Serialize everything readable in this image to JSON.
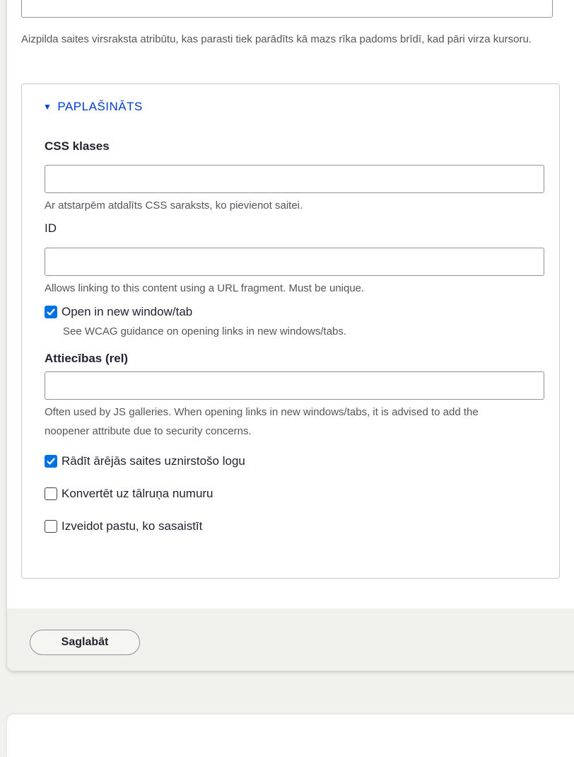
{
  "title_field": {
    "value": "",
    "description": "Aizpilda saites virsraksta atribūtu, kas parasti tiek parādīts kā mazs rīka padoms brīdī, kad pāri virza kursoru."
  },
  "advanced": {
    "summary": "PAPLAŠINĀTS",
    "css": {
      "label": "CSS klases",
      "value": "",
      "description": "Ar atstarpēm atdalīts CSS saraksts, ko pievienot saitei."
    },
    "id": {
      "label": "ID",
      "value": "",
      "description": "Allows linking to this content using a URL fragment. Must be unique."
    },
    "new_window": {
      "label": "Open in new window/tab",
      "checked": true,
      "description": "See WCAG guidance on opening links in new windows/tabs."
    },
    "rel": {
      "label": "Attiecības (rel)",
      "value": "",
      "description": "Often used by JS galleries. When opening links in new windows/tabs, it is advised to add the noopener attribute due to security concerns."
    },
    "external_popup": {
      "label": "Rādīt ārējās saites uznirstošo logu",
      "checked": true
    },
    "phone": {
      "label": "Konvertēt uz tālruņa numuru",
      "checked": false
    },
    "email": {
      "label": "Izveidot pastu, ko sasaistīt",
      "checked": false
    }
  },
  "footer": {
    "save_label": "Saglabāt"
  },
  "colors": {
    "link": "#003ecc",
    "checkbox_on": "#0071e3",
    "page_bg": "#f1f1ee"
  }
}
